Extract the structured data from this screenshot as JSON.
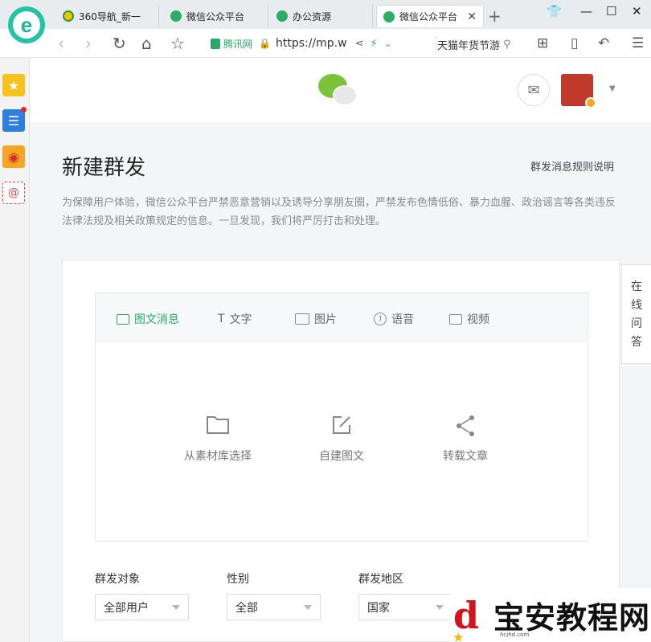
{
  "browser": {
    "tabs": [
      {
        "label": "360导航_新一",
        "active": false
      },
      {
        "label": "微信公众平台",
        "active": false
      },
      {
        "label": "办公资源",
        "active": false
      },
      {
        "label": "微信公众平台",
        "active": true
      }
    ],
    "address": {
      "site_badge": "腾讯网",
      "url": "https://mp.w"
    },
    "search_text": "天猫年货节游"
  },
  "header": {},
  "page": {
    "title": "新建群发",
    "rules_link": "群发消息规则说明",
    "notice": "为保障用户体验，微信公众平台严禁恶意营销以及诱导分享朋友圈，严禁发布色情低俗、暴力血腥、政治谣言等各类违反法律法规及相关政策规定的信息。一旦发现，我们将严厉打击和处理。"
  },
  "editor": {
    "tabs": [
      {
        "label": "图文消息",
        "icon": "news-icon",
        "active": true
      },
      {
        "label": "文字",
        "icon": "text-icon",
        "active": false
      },
      {
        "label": "图片",
        "icon": "image-icon",
        "active": false
      },
      {
        "label": "语音",
        "icon": "voice-icon",
        "active": false
      },
      {
        "label": "视频",
        "icon": "video-icon",
        "active": false
      }
    ],
    "options": [
      {
        "label": "从素材库选择",
        "icon": "folder-icon"
      },
      {
        "label": "自建图文",
        "icon": "edit-icon"
      },
      {
        "label": "转载文章",
        "icon": "share-icon"
      }
    ]
  },
  "filters": {
    "target": {
      "label": "群发对象",
      "value": "全部用户"
    },
    "gender": {
      "label": "性别",
      "value": "全部"
    },
    "region": {
      "label": "群发地区",
      "value": "国家"
    }
  },
  "qa": {
    "chars": [
      "在",
      "线",
      "问",
      "答"
    ]
  },
  "watermark": {
    "text": "宝安教程网",
    "url": "hcjhd.com"
  },
  "colors": {
    "accent": "#2aa86a",
    "wechat_green": "#7bc33d"
  }
}
